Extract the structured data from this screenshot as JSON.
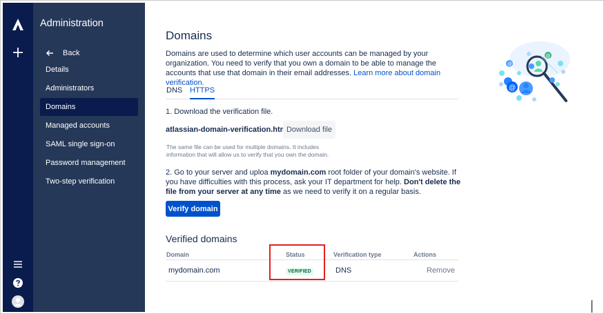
{
  "sidebar": {
    "title": "Administration",
    "back_label": "Back",
    "items": [
      {
        "label": "Details"
      },
      {
        "label": "Administrators"
      },
      {
        "label": "Domains"
      },
      {
        "label": "Managed accounts"
      },
      {
        "label": "SAML single sign-on"
      },
      {
        "label": "Password management"
      },
      {
        "label": "Two-step verification"
      }
    ],
    "active_item": "Domains"
  },
  "page": {
    "title": "Domains",
    "intro_text": "Domains are used to determine which user accounts can be managed by your organization. You need to verify that you own a domain to be able to manage the accounts that use that domain in their email addresses. ",
    "intro_link": "Learn more about domain verification."
  },
  "tabs": [
    {
      "label": "DNS"
    },
    {
      "label": "HTTPS"
    }
  ],
  "active_tab": "HTTPS",
  "https": {
    "step1": "1. Download the verification file.",
    "filename": "atlassian-domain-verification.html",
    "download_label": "Download file",
    "hint": "The same file can be used for multiple domains. It includes information that will allow us to verify that you own the domain.",
    "step2_a": "2. Go to your server and uploa ",
    "step2_domain": "mydomain.com",
    "step2_b": " root folder of your domain's website. If you have difficulties with this process, ask your IT department for help. ",
    "step2_bold": "Don't delete the file from your server at any time",
    "step2_c": " as we need to verify it on a regular basis.",
    "verify_label": "Verify domain"
  },
  "verified": {
    "title": "Verified domains",
    "columns": [
      "Domain",
      "Status",
      "Verification type",
      "Actions"
    ],
    "rows": [
      {
        "domain": "mydomain.com",
        "status": "VERIFIED",
        "type": "DNS",
        "action": "Remove"
      }
    ]
  },
  "colors": {
    "global_nav": "#0A1C4D",
    "side_nav": "#253858",
    "primary": "#0052CC",
    "highlight": "#E0211C",
    "verified_bg": "#E3FCEF",
    "verified_text": "#006644"
  },
  "icons": [
    "atlassian-logo-icon",
    "plus-icon",
    "menu-icon",
    "help-icon",
    "avatar-icon",
    "back-arrow-icon",
    "domain-illustration"
  ]
}
